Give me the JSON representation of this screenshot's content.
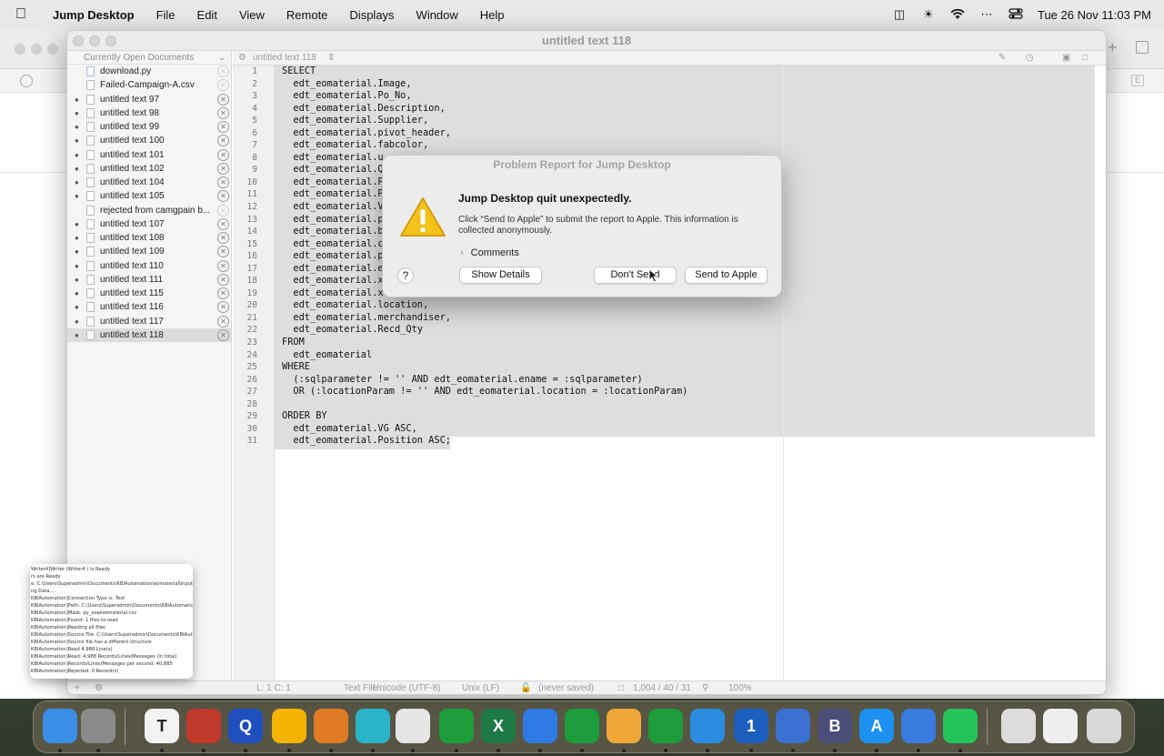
{
  "menubar": {
    "app": "Jump Desktop",
    "items": [
      "File",
      "Edit",
      "View",
      "Remote",
      "Displays",
      "Window",
      "Help"
    ],
    "clock": "Tue 26 Nov  11:03 PM"
  },
  "window": {
    "title": "untitled text 118",
    "nav_file": "untitled text 118"
  },
  "sidebar": {
    "header": "Currently Open Documents",
    "documents": [
      {
        "name": "download.py",
        "dirty": false
      },
      {
        "name": "Failed-Campaign-A.csv",
        "dirty": false
      },
      {
        "name": "untitled text 97",
        "dirty": true
      },
      {
        "name": "untitled text 98",
        "dirty": true
      },
      {
        "name": "untitled text 99",
        "dirty": true
      },
      {
        "name": "untitled text 100",
        "dirty": true
      },
      {
        "name": "untitled text 101",
        "dirty": true
      },
      {
        "name": "untitled text 102",
        "dirty": true
      },
      {
        "name": "untitled text 104",
        "dirty": true
      },
      {
        "name": "untitled text 105",
        "dirty": true
      },
      {
        "name": "rejected from camgpain b...",
        "dirty": false
      },
      {
        "name": "untitled text 107",
        "dirty": true
      },
      {
        "name": "untitled text 108",
        "dirty": true
      },
      {
        "name": "untitled text 109",
        "dirty": true
      },
      {
        "name": "untitled text 110",
        "dirty": true
      },
      {
        "name": "untitled text 111",
        "dirty": true
      },
      {
        "name": "untitled text 115",
        "dirty": true
      },
      {
        "name": "untitled text 116",
        "dirty": true
      },
      {
        "name": "untitled text 117",
        "dirty": true
      },
      {
        "name": "untitled text 118",
        "dirty": true
      }
    ]
  },
  "code": [
    "SELECT",
    "  edt_eomaterial.Image,",
    "  edt_eomaterial.Po_No,",
    "  edt_eomaterial.Description,",
    "  edt_eomaterial.Supplier,",
    "  edt_eomaterial.pivot_header,",
    "  edt_eomaterial.fabcolor,",
    "  edt_eomaterial.u",
    "  edt_eomaterial.Q",
    "  edt_eomaterial.P",
    "  edt_eomaterial.P",
    "  edt_eomaterial.V",
    "  edt_eomaterial.p",
    "  edt_eomaterial.b",
    "  edt_eomaterial.c",
    "  edt_eomaterial.p",
    "  edt_eomaterial.e",
    "  edt_eomaterial.x",
    "  edt_eomaterial.x",
    "  edt_eomaterial.location,",
    "  edt_eomaterial.merchandiser,",
    "  edt_eomaterial.Recd_Qty",
    "FROM",
    "  edt_eomaterial",
    "WHERE",
    "  (:sqlparameter != '' AND edt_eomaterial.ename = :sqlparameter)",
    "  OR (:locationParam != '' AND edt_eomaterial.location = :locationParam)",
    "",
    "ORDER BY",
    "  edt_eomaterial.VG ASC,",
    "  edt_eomaterial.Position ASC;"
  ],
  "status": {
    "position": "L: 1 C: 1",
    "file_type": "Text File",
    "encoding": "Unicode (UTF-8)",
    "line_endings": "Unix (LF)",
    "saved": "(never saved)",
    "counts": "1,004 / 40 / 31",
    "zoom": "100%"
  },
  "dialog": {
    "title": "Problem Report for Jump Desktop",
    "heading": "Jump Desktop quit unexpectedly.",
    "message": "Click “Send to Apple” to submit the report to Apple. This information is collected anonymously.",
    "comments": "Comments",
    "help": "?",
    "show_details": "Show Details",
    "dont_send": "Don't Send",
    "send": "Send to Apple"
  },
  "thumbnail": {
    "lines": [
      "Writer4]Writer (Writer4 ) Is Ready",
      "rs are Ready",
      "e: C:\\Users\\Superadmin\\Documents\\KBIAutomation\\eomaterial\\input\\edt_e",
      "ng Data....",
      "KBIAutomation]Connection Type is: Text",
      "KBIAutomation]Path: C:\\Users\\Superadmin\\Documents\\KBIAutomation\\eoma",
      "KBIAutomation]Mask: py_eowisematerial.csv",
      "KBIAutomation]Found: 1 files to read",
      "KBIAutomation]Reading all files",
      "KBIAutomation]Source File: C:\\Users\\Superadmin\\Documents\\KBIAutomation",
      "KBIAutomation]Source file has a different structure",
      "KBIAutomation]Read 4,988 Line(s)",
      "KBIAutomation]Read: 4,988 Records/Lines/Messages (in total)",
      "KBIAutomation]Records/Lines/Messages per second: 40,885",
      "KBIAutomation]Rejected: 0 Record(s)"
    ]
  },
  "dock": {
    "apps": [
      {
        "name": "finder",
        "label": "",
        "color": "#3a8ee6"
      },
      {
        "name": "system-settings",
        "label": "",
        "color": "#8a8a8a"
      },
      {
        "name": "typora",
        "label": "T",
        "color": "#f2f2f2"
      },
      {
        "name": "toolbox",
        "label": "",
        "color": "#c0392b"
      },
      {
        "name": "quicktime",
        "label": "Q",
        "color": "#1f4fbf"
      },
      {
        "name": "pages",
        "label": "",
        "color": "#f5b400"
      },
      {
        "name": "books",
        "label": "",
        "color": "#e07b25"
      },
      {
        "name": "network",
        "label": "",
        "color": "#2bb3c9"
      },
      {
        "name": "chrome",
        "label": "",
        "color": "#e5e5e5"
      },
      {
        "name": "kingswaysoft-1",
        "label": "",
        "color": "#1c9c3a"
      },
      {
        "name": "excel",
        "label": "X",
        "color": "#1d7a45"
      },
      {
        "name": "jump-desktop",
        "label": "",
        "color": "#2f7ae5"
      },
      {
        "name": "kingswaysoft-2",
        "label": "",
        "color": "#1c9c3a"
      },
      {
        "name": "paw",
        "label": "",
        "color": "#f0a73a"
      },
      {
        "name": "kingswaysoft-3",
        "label": "",
        "color": "#1c9c3a"
      },
      {
        "name": "safari",
        "label": "",
        "color": "#2c8de0"
      },
      {
        "name": "onepassword",
        "label": "1",
        "color": "#1d5fbe"
      },
      {
        "name": "xcode-tools",
        "label": "",
        "color": "#3b6fd0"
      },
      {
        "name": "bbedit",
        "label": "B",
        "color": "#4a4d78"
      },
      {
        "name": "app-store",
        "label": "A",
        "color": "#1e90f0"
      },
      {
        "name": "readkit",
        "label": "",
        "color": "#3a7be0"
      },
      {
        "name": "whatsapp",
        "label": "",
        "color": "#25c45a"
      },
      {
        "name": "downloads-stack",
        "label": "",
        "color": "#dcdcdc"
      },
      {
        "name": "document-stack",
        "label": "",
        "color": "#eeeeee"
      },
      {
        "name": "trash",
        "label": "",
        "color": "#d8d8d8"
      }
    ]
  }
}
